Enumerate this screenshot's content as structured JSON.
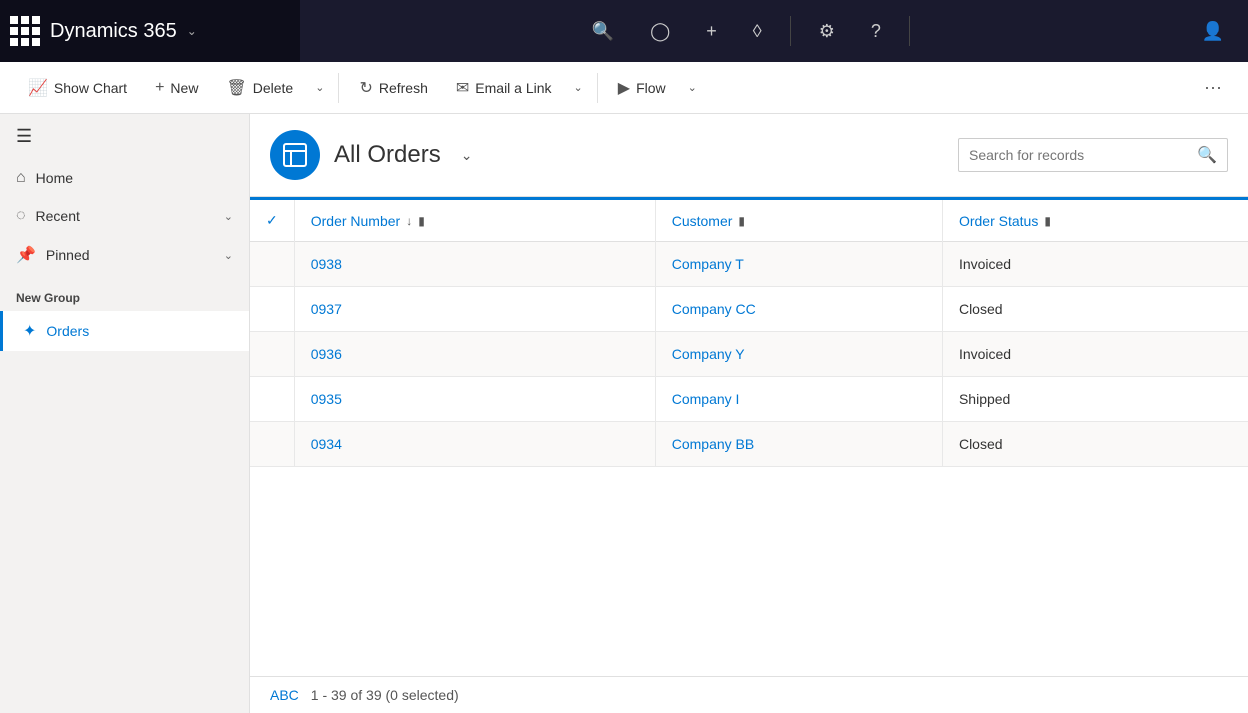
{
  "topnav": {
    "app_title": "Dynamics 365",
    "grid_icon": "grid",
    "search_icon": "🔍",
    "recent_icon": "⏱",
    "plus_icon": "+",
    "filter_icon": "⊽",
    "settings_icon": "⚙",
    "help_icon": "?",
    "user_icon": "👤"
  },
  "toolbar": {
    "show_chart_label": "Show Chart",
    "new_label": "New",
    "delete_label": "Delete",
    "refresh_label": "Refresh",
    "email_link_label": "Email a Link",
    "flow_label": "Flow",
    "more_icon": "···"
  },
  "sidebar": {
    "home_label": "Home",
    "recent_label": "Recent",
    "pinned_label": "Pinned",
    "new_group_label": "New Group",
    "orders_label": "Orders"
  },
  "page_header": {
    "title": "All Orders",
    "search_placeholder": "Search for records"
  },
  "table": {
    "columns": [
      {
        "id": "order_number",
        "label": "Order Number",
        "has_sort": true,
        "has_filter": true
      },
      {
        "id": "customer",
        "label": "Customer",
        "has_sort": false,
        "has_filter": true
      },
      {
        "id": "order_status",
        "label": "Order Status",
        "has_sort": false,
        "has_filter": true
      }
    ],
    "rows": [
      {
        "order_number": "0938",
        "customer": "Company T",
        "status": "Invoiced"
      },
      {
        "order_number": "0937",
        "customer": "Company CC",
        "status": "Closed"
      },
      {
        "order_number": "0936",
        "customer": "Company Y",
        "status": "Invoiced"
      },
      {
        "order_number": "0935",
        "customer": "Company I",
        "status": "Shipped"
      },
      {
        "order_number": "0934",
        "customer": "Company BB",
        "status": "Closed"
      }
    ]
  },
  "footer": {
    "abc_label": "ABC",
    "paging_info": "1 - 39 of 39 (0 selected)"
  }
}
